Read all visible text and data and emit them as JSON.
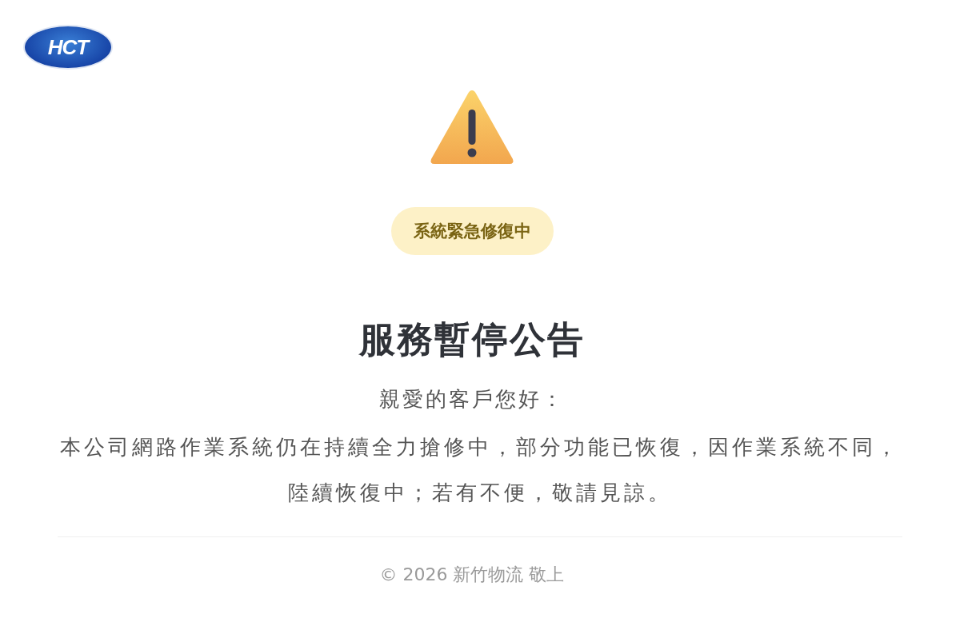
{
  "logo": {
    "text": "HCT"
  },
  "status_badge": {
    "label": "系統緊急修復中"
  },
  "title": "服務暫停公告",
  "greeting": "親愛的客戶您好：",
  "message": "本公司網路作業系統仍在持續全力搶修中，部分功能已恢復，因作業系統不同，陸續恢復中；若有不便，敬請見諒。",
  "footer": "© 2026 新竹物流 敬上"
}
